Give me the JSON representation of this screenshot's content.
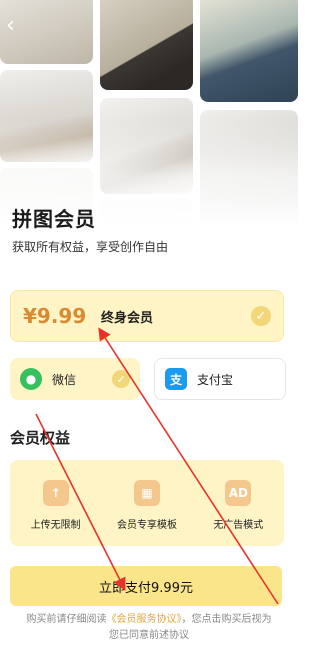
{
  "header": {
    "back_icon": "chevron-left-icon"
  },
  "hero": {
    "title": "拼图会员",
    "subtitle": "获取所有权益，享受创作自由"
  },
  "plan": {
    "price": "¥9.99",
    "name": "终身会员",
    "selected": true
  },
  "payment": {
    "wechat": {
      "label": "微信",
      "icon": "wechat-icon",
      "selected": true
    },
    "alipay": {
      "label": "支付宝",
      "icon": "alipay-icon",
      "selected": false
    }
  },
  "benefits": {
    "title": "会员权益",
    "items": [
      {
        "label": "上传无限制",
        "icon": "upload-cloud-icon"
      },
      {
        "label": "会员专享模板",
        "icon": "template-icon"
      },
      {
        "label": "无广告模式",
        "icon": "ad-icon",
        "icon_text": "AD"
      }
    ]
  },
  "cta": {
    "label": "立即支付9.99元"
  },
  "notice": {
    "prefix": "购买前请仔细阅读",
    "link": "《会员服务协议》",
    "suffix": "，您点击购买后视为",
    "line2": "您已同意前述协议"
  },
  "colors": {
    "accent": "#fbe58a",
    "card_bg": "#fff4c6",
    "price": "#d98a33",
    "wechat": "#36c160",
    "alipay": "#1a9bf0",
    "annotation_arrow": "#e8322b"
  }
}
